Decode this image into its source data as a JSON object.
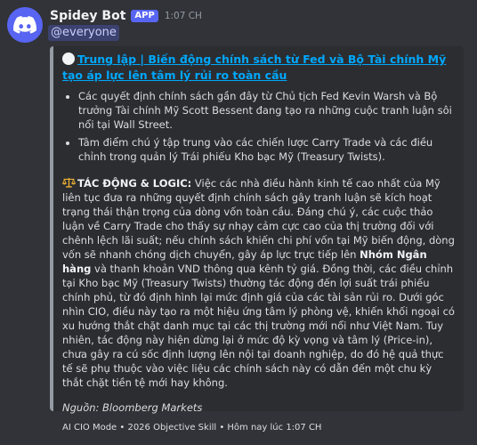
{
  "message": {
    "username": "Spidey Bot",
    "badge": "APP",
    "timestamp": "1:07 CH",
    "mention": "@everyone"
  },
  "embed": {
    "title": "Trung lập | Biến động chính sách từ Fed và Bộ Tài chính Mỹ tạo áp lực lên tâm lý rủi ro toàn cầu",
    "bullets": [
      "Các quyết định chính sách gần đây từ Chủ tịch Fed Kevin Warsh và Bộ trưởng Tài chính Mỹ Scott Bessent đang tạo ra những cuộc tranh luận sôi nổi tại Wall Street.",
      "Tâm điểm chú ý tập trung vào các chiến lược Carry Trade và các điều chỉnh trong quản lý Trái phiếu Kho bạc Mỹ (Treasury Twists)."
    ],
    "impact_label": "TÁC ĐỘNG & LOGIC:",
    "impact_part1": " Việc các nhà điều hành kinh tế cao nhất của Mỹ liên tục đưa ra những quyết định chính sách gây tranh luận sẽ kích hoạt trạng thái thận trọng của dòng vốn toàn cầu. Đáng chú ý, các cuộc thảo luận về Carry Trade cho thấy sự nhạy cảm cực cao của thị trường đối với chênh lệch lãi suất; nếu chính sách khiến chi phí vốn tại Mỹ biến động, dòng vốn sẽ nhanh chóng dịch chuyển, gây áp lực trực tiếp lên ",
    "impact_highlight": "Nhóm Ngân hàng",
    "impact_part2": " và thanh khoản VND thông qua kênh tỷ giá. Đồng thời, các điều chỉnh tại Kho bạc Mỹ (Treasury Twists) thường tác động đến lợi suất trái phiếu chính phủ, từ đó định hình lại mức định giá của các tài sản rủi ro. Dưới góc nhìn CIO, điều này tạo ra một hiệu ứng tâm lý phòng vệ, khiến khối ngoại có xu hướng thắt chặt danh mục tại các thị trường mới nổi như Việt Nam. Tuy nhiên, tác động này hiện dừng lại ở mức độ kỳ vọng và tâm lý (Price-in), chưa gây ra cú sốc định lượng lên nội tại doanh nghiệp, do đó hệ quả thực tế sẽ phụ thuộc vào việc liệu các chính sách này có dẫn đến một chu kỳ thắt chặt tiền tệ mới hay không.",
    "source": "Nguồn: Bloomberg Markets",
    "footer": "AI CIO Mode • 2026 Objective Skill • Hôm nay lúc 1:07 CH"
  },
  "colors": {
    "background": "#313338",
    "embed_bg": "#2b2d31",
    "embed_border": "#949ba4",
    "link": "#00a8fc",
    "blurple": "#5865f2"
  },
  "icons": {
    "avatar": "discord-logo-icon",
    "title_marker": "white-circle-icon",
    "impact_marker": "balance-scale-icon"
  }
}
